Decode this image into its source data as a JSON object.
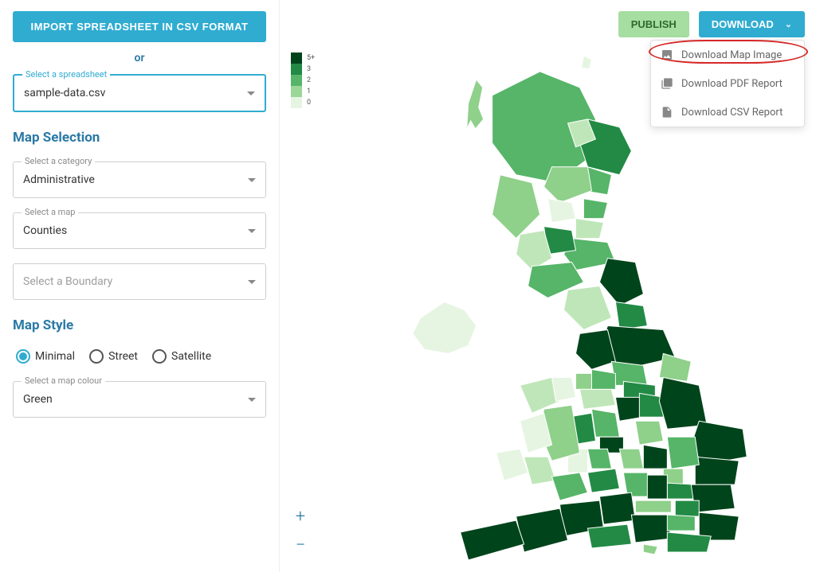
{
  "sidebar": {
    "import_button": "IMPORT SPREADSHEET IN CSV FORMAT",
    "or": "or",
    "spreadsheet": {
      "label": "Select a spreadsheet",
      "value": "sample-data.csv"
    },
    "map_selection_title": "Map Selection",
    "category": {
      "label": "Select a category",
      "value": "Administrative"
    },
    "map": {
      "label": "Select a map",
      "value": "Counties"
    },
    "boundary": {
      "placeholder": "Select a Boundary"
    },
    "map_style_title": "Map Style",
    "styles": [
      {
        "label": "Minimal",
        "selected": true
      },
      {
        "label": "Street",
        "selected": false
      },
      {
        "label": "Satellite",
        "selected": false
      }
    ],
    "colour": {
      "label": "Select a map colour",
      "value": "Green"
    }
  },
  "toolbar": {
    "publish": "PUBLISH",
    "download": "DOWNLOAD",
    "menu": [
      "Download Map Image",
      "Download PDF Report",
      "Download CSV Report"
    ]
  },
  "legend": {
    "values": [
      "5+",
      "3",
      "2",
      "1",
      "0"
    ],
    "colors": [
      "#00441b",
      "#228a44",
      "#56b568",
      "#9ad798",
      "#e6f5e1"
    ]
  },
  "zoom": {
    "in": "+",
    "out": "−"
  },
  "map_palette": {
    "c0": "#e6f5e1",
    "c1": "#bfe6b8",
    "c2": "#8fd08a",
    "c3": "#56b568",
    "c4": "#228a44",
    "c5": "#00441b"
  }
}
